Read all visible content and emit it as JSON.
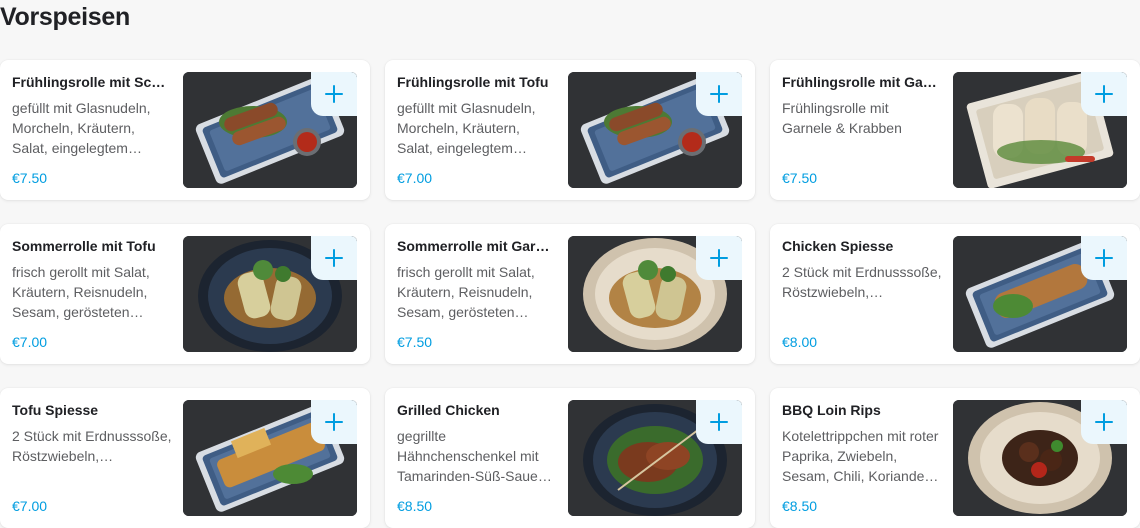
{
  "section": {
    "title": "Vorspeisen"
  },
  "items": [
    {
      "name": "Frühlingsrolle mit Schwein",
      "name_display": "Frühlingsrolle mit Sc…",
      "desc": "gefüllt mit Glasnudeln, Morcheln, Kräutern, Salat, eingelegtem…",
      "price": "€7.50",
      "image": "spring-roll-plate",
      "plate": "blue-rect"
    },
    {
      "name": "Frühlingsrolle mit Tofu",
      "name_display": "Frühlingsrolle mit Tofu",
      "desc": "gefüllt mit Glasnudeln, Morcheln, Kräutern, Salat, eingelegtem…",
      "price": "€7.00",
      "image": "spring-roll-plate",
      "plate": "blue-rect"
    },
    {
      "name": "Frühlingsrolle mit Garnele",
      "name_display": "Frühlingsrolle mit Ga…",
      "desc": "Frühlingsrolle mit Garnele & Krabben",
      "price": "€7.50",
      "image": "rice-paper-roll-plate",
      "plate": "cream-square"
    },
    {
      "name": "Sommerrolle mit Tofu",
      "name_display": "Sommerrolle mit Tofu",
      "desc": "frisch gerollt mit Salat, Kräutern, Reisnudeln, Sesam, gerösteten…",
      "price": "€7.00",
      "image": "summer-roll-bowl",
      "plate": "dark-round"
    },
    {
      "name": "Sommerrolle mit Garnele",
      "name_display": "Sommerrolle mit Gar…",
      "desc": "frisch gerollt mit Salat, Kräutern, Reisnudeln, Sesam, gerösteten…",
      "price": "€7.50",
      "image": "summer-roll-bowl",
      "plate": "beige-round"
    },
    {
      "name": "Chicken Spiesse",
      "name_display": "Chicken Spiesse",
      "desc": "2 Stück mit Erdnusssoße, Röstzwiebeln,…",
      "price": "€8.00",
      "image": "skewer-plate",
      "plate": "blue-rect"
    },
    {
      "name": "Tofu Spiesse",
      "name_display": "Tofu Spiesse",
      "desc": "2 Stück mit Erdnusssoße, Röstzwiebeln,…",
      "price": "€7.00",
      "image": "tofu-skewer-plate",
      "plate": "blue-rect"
    },
    {
      "name": "Grilled Chicken",
      "name_display": "Grilled Chicken",
      "desc": "gegrillte Hähnchenschenkel mit Tamarinden-Süß-Saue…",
      "price": "€8.50",
      "image": "grilled-chicken-bowl",
      "plate": "dark-round"
    },
    {
      "name": "BBQ Loin Rips",
      "name_display": "BBQ Loin Rips",
      "desc": "Kotelettrippchen mit roter Paprika, Zwiebeln, Sesam, Chili, Koriande…",
      "price": "€8.50",
      "image": "bbq-ribs-bowl",
      "plate": "beige-round"
    }
  ],
  "add_button": {
    "icon": "plus-icon",
    "label": "+"
  },
  "colors": {
    "accent": "#009de0",
    "accent_bg": "#ebf7fd",
    "page_bg": "#f7f7f7",
    "card_bg": "#ffffff",
    "text_primary": "#202125",
    "text_secondary": "#5d5e61"
  }
}
